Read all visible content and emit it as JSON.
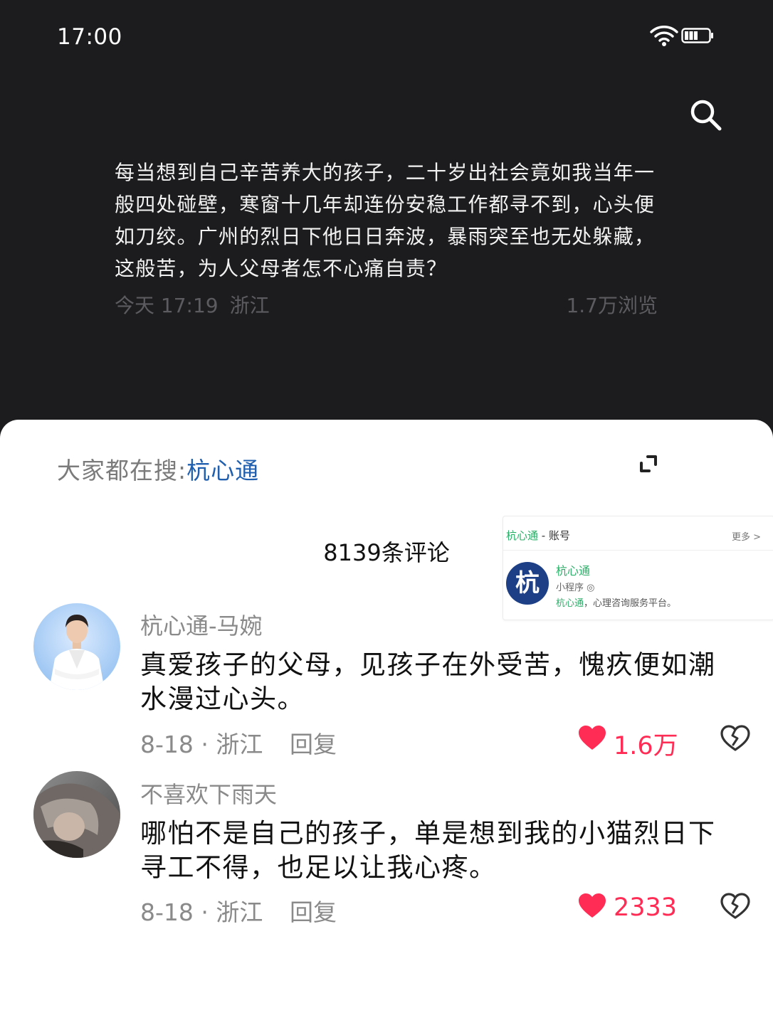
{
  "status_bar": {
    "time": "17:00"
  },
  "post": {
    "text": "每当想到自己辛苦养大的孩子，二十岁出社会竟如我当年一般四处碰壁，寒窗十几年却连份安稳工作都寻不到，心头便如刀绞。广州的烈日下他日日奔波，暴雨突至也无处躲藏，这般苦，为人父母者怎不心痛自责？",
    "date": "今天 17:19",
    "location": "浙江",
    "views": "1.7万浏览"
  },
  "hot_search": {
    "prefix": "大家都在搜:",
    "keyword": "杭心通"
  },
  "comment_count": "8139条评论",
  "mini_program_card": {
    "title": "杭心通",
    "title_suffix": " - 账号",
    "more": "更多 >",
    "logo_char": "杭",
    "name": "杭心通",
    "type": "小程序 ◎",
    "desc_highlight": "杭心通",
    "desc_rest": "，心理咨询服务平台。"
  },
  "comments": [
    {
      "author": "杭心通-马婉",
      "text": "真爱孩子的父母，见孩子在外受苦，愧疚便如潮水漫过心头。",
      "date_location": "8-18 · 浙江",
      "reply_label": "回复",
      "likes": "1.6万"
    },
    {
      "author": "不喜欢下雨天",
      "text": "哪怕不是自己的孩子，单是想到我的小猫烈日下寻工不得，也足以让我心疼。",
      "date_location": "8-18 · 浙江",
      "reply_label": "回复",
      "likes": "2333"
    }
  ],
  "colors": {
    "like": "#ff2d55",
    "link": "#1f5fae",
    "mini_program_green": "#2aae67",
    "dark_bg": "#1c1c1e"
  }
}
